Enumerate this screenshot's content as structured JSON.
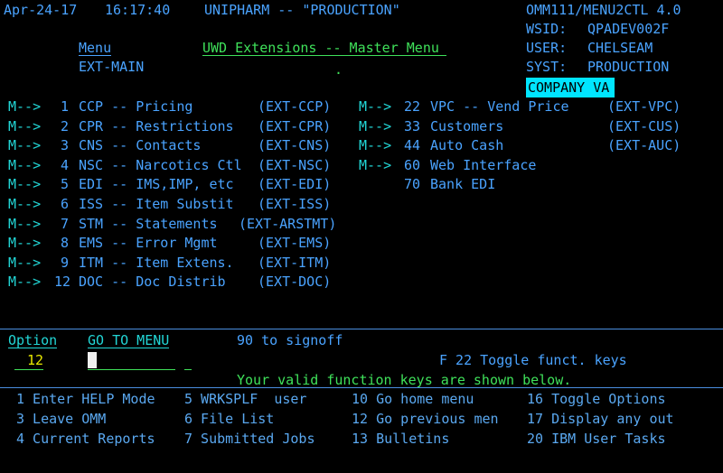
{
  "header": {
    "date": "Apr-24-17",
    "time": "16:17:40",
    "system_title": "UNIPHARM -- \"PRODUCTION\"",
    "program": "OMM111/MENU2CTL 4.0",
    "wsid_label": "WSID:",
    "wsid_value": "QPADEV002F",
    "user_label": "USER:",
    "user_value": "CHELSEAM",
    "syst_label": "SYST:",
    "syst_value": "PRODUCTION",
    "company": "COMPANY VA",
    "menu_label": "Menu",
    "menu_name": "EXT-MAIN",
    "menu_title": "UWD Extensions -- Master Menu",
    "dot": "."
  },
  "menu_left": [
    {
      "marker": "M-->",
      "num": "1",
      "desc": "CCP -- Pricing",
      "code": "(EXT-CCP)"
    },
    {
      "marker": "M-->",
      "num": "2",
      "desc": "CPR -- Restrictions",
      "code": "(EXT-CPR)"
    },
    {
      "marker": "M-->",
      "num": "3",
      "desc": "CNS -- Contacts",
      "code": "(EXT-CNS)"
    },
    {
      "marker": "M-->",
      "num": "4",
      "desc": "NSC -- Narcotics Ctl",
      "code": "(EXT-NSC)"
    },
    {
      "marker": "M-->",
      "num": "5",
      "desc": "EDI -- IMS,IMP, etc",
      "code": "(EXT-EDI)"
    },
    {
      "marker": "M-->",
      "num": "6",
      "desc": "ISS -- Item Substit",
      "code": "(EXT-ISS)"
    },
    {
      "marker": "M-->",
      "num": "7",
      "desc": "STM -- Statements",
      "code": "(EXT-ARSTMT)"
    },
    {
      "marker": "M-->",
      "num": "8",
      "desc": "EMS -- Error Mgmt",
      "code": "(EXT-EMS)"
    },
    {
      "marker": "M-->",
      "num": "9",
      "desc": "ITM -- Item Extens.",
      "code": "(EXT-ITM)"
    },
    {
      "marker": "M-->",
      "num": "12",
      "desc": "DOC -- Doc Distrib",
      "code": "(EXT-DOC)"
    }
  ],
  "menu_right": [
    {
      "marker": "M-->",
      "num": "22",
      "desc": "VPC -- Vend Price",
      "code": "(EXT-VPC)"
    },
    {
      "marker": "M-->",
      "num": "33",
      "desc": "Customers",
      "code": "(EXT-CUS)"
    },
    {
      "marker": "M-->",
      "num": "44",
      "desc": "Auto Cash",
      "code": "(EXT-AUC)"
    },
    {
      "marker": "M-->",
      "num": "60",
      "desc": "Web Interface",
      "code": ""
    },
    {
      "marker": "",
      "num": "70",
      "desc": "Bank EDI",
      "code": ""
    }
  ],
  "command": {
    "option_label": "Option",
    "option_value": "12",
    "goto_label": "GO TO MENU",
    "goto_value": "",
    "signoff": "90 to signoff",
    "toggle_hint": "F 22 Toggle funct. keys",
    "valid_keys_msg": "Your valid function keys are shown below."
  },
  "function_keys": {
    "row1": [
      "1 Enter HELP Mode",
      "5 WRKSPLF  user",
      "10 Go home menu",
      "16 Toggle Options"
    ],
    "row2": [
      "3 Leave OMM",
      "6 File List",
      "12 Go previous men",
      "17 Display any out"
    ],
    "row3": [
      "4 Current Reports",
      "7 Submitted Jobs",
      "13 Bulletins",
      "20 IBM User Tasks"
    ]
  }
}
